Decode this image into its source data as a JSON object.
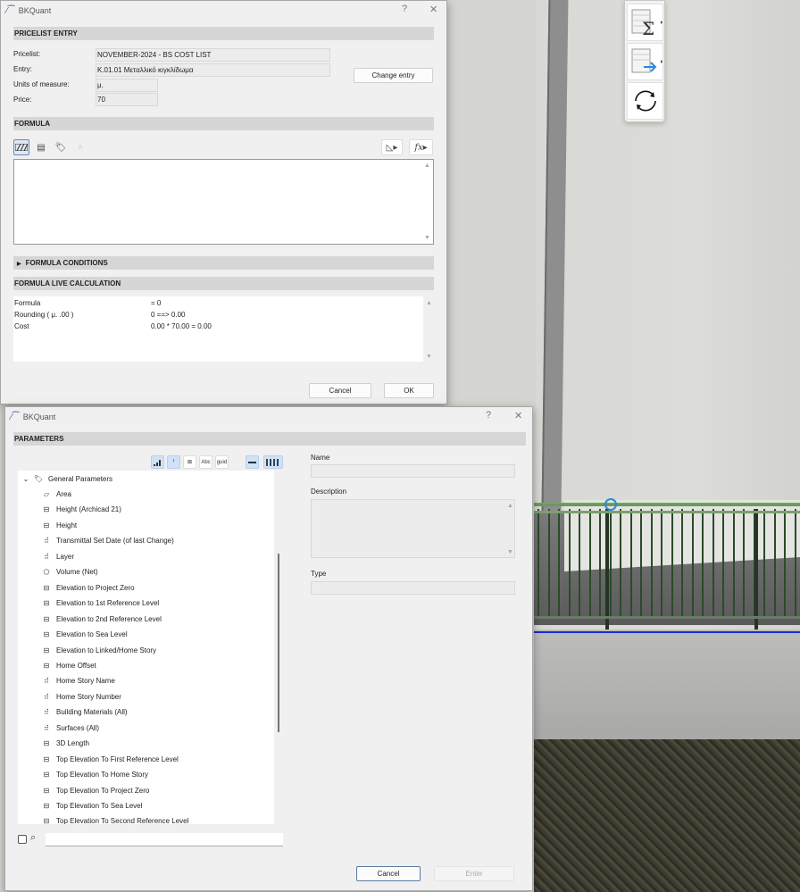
{
  "palette": {
    "icons": [
      "table-sum-icon",
      "table-export-icon",
      "refresh-icon"
    ]
  },
  "dialog1": {
    "title": "BKQuant",
    "help": "?",
    "close": "✕",
    "pricelist_section": "PRICELIST ENTRY",
    "pricelist_label": "Pricelist:",
    "pricelist_value": "NOVEMBER-2024  -  BS COST LIST",
    "entry_label": "Entry:",
    "entry_value": "K.01.01  Μεταλλικό κιγκλίδωμα",
    "units_label": "Units of measure:",
    "units_value": "μ.",
    "price_label": "Price:",
    "price_value": "70",
    "change_entry": "Change entry",
    "formula_section": "FORMULA",
    "formula_value": "",
    "fx": "fx",
    "conditions_section": "FORMULA CONDITIONS",
    "live_section": "FORMULA LIVE CALCULATION",
    "calc": [
      {
        "label": "Formula",
        "value": " = 0"
      },
      {
        "label": "Rounding ( μ.  .00 )",
        "value": "0  ==>  0.00"
      },
      {
        "label": "Cost",
        "value": "0.00 * 70.00 = 0.00"
      }
    ],
    "cancel": "Cancel",
    "ok": "OK"
  },
  "dialog2": {
    "title": "BKQuant",
    "help": "?",
    "close": "✕",
    "section": "PARAMETERS",
    "tools": [
      "",
      "",
      "⊠",
      "Abc",
      "guid",
      "",
      ""
    ],
    "group": "General Parameters",
    "items": [
      {
        "label": "Area",
        "icon": "area"
      },
      {
        "label": "Height (Archicad 21)",
        "icon": "dim"
      },
      {
        "label": "Height",
        "icon": "dim"
      },
      {
        "label": "Transmittal Set Date (of last Change)",
        "icon": "list"
      },
      {
        "label": "Layer",
        "icon": "list"
      },
      {
        "label": "Volume (Net)",
        "icon": "volume"
      },
      {
        "label": "Elevation to Project Zero",
        "icon": "dim"
      },
      {
        "label": "Elevation to 1st Reference Level",
        "icon": "dim"
      },
      {
        "label": "Elevation to 2nd Reference Level",
        "icon": "dim"
      },
      {
        "label": "Elevation to Sea Level",
        "icon": "dim"
      },
      {
        "label": "Elevation to Linked/Home Story",
        "icon": "dim"
      },
      {
        "label": "Home Offset",
        "icon": "dim"
      },
      {
        "label": "Home Story Name",
        "icon": "list"
      },
      {
        "label": "Home Story Number",
        "icon": "list"
      },
      {
        "label": "Building Materials (All)",
        "icon": "list"
      },
      {
        "label": "Surfaces (All)",
        "icon": "list"
      },
      {
        "label": "3D Length",
        "icon": "dim"
      },
      {
        "label": "Top Elevation To First Reference Level",
        "icon": "dim"
      },
      {
        "label": "Top Elevation To Home Story",
        "icon": "dim"
      },
      {
        "label": "Top Elevation To Project Zero",
        "icon": "dim"
      },
      {
        "label": "Top Elevation To Sea Level",
        "icon": "dim"
      },
      {
        "label": "Top Elevation To Second Reference Level",
        "icon": "dim"
      }
    ],
    "search_value": "",
    "name_label": "Name",
    "name_value": "",
    "description_label": "Description",
    "description_value": "",
    "type_label": "Type",
    "type_value": "",
    "cancel": "Cancel",
    "enter": "Enter"
  }
}
